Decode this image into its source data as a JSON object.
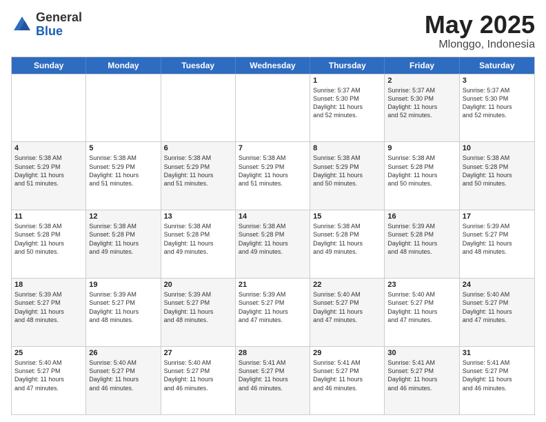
{
  "logo": {
    "general": "General",
    "blue": "Blue"
  },
  "header": {
    "month": "May 2025",
    "location": "Mlonggo, Indonesia"
  },
  "weekdays": [
    "Sunday",
    "Monday",
    "Tuesday",
    "Wednesday",
    "Thursday",
    "Friday",
    "Saturday"
  ],
  "rows": [
    [
      {
        "day": "",
        "text": "",
        "alt": false
      },
      {
        "day": "",
        "text": "",
        "alt": true
      },
      {
        "day": "",
        "text": "",
        "alt": false
      },
      {
        "day": "",
        "text": "",
        "alt": true
      },
      {
        "day": "1",
        "text": "Sunrise: 5:37 AM\nSunset: 5:30 PM\nDaylight: 11 hours\nand 52 minutes.",
        "alt": false
      },
      {
        "day": "2",
        "text": "Sunrise: 5:37 AM\nSunset: 5:30 PM\nDaylight: 11 hours\nand 52 minutes.",
        "alt": true
      },
      {
        "day": "3",
        "text": "Sunrise: 5:37 AM\nSunset: 5:30 PM\nDaylight: 11 hours\nand 52 minutes.",
        "alt": false
      }
    ],
    [
      {
        "day": "4",
        "text": "Sunrise: 5:38 AM\nSunset: 5:29 PM\nDaylight: 11 hours\nand 51 minutes.",
        "alt": true
      },
      {
        "day": "5",
        "text": "Sunrise: 5:38 AM\nSunset: 5:29 PM\nDaylight: 11 hours\nand 51 minutes.",
        "alt": false
      },
      {
        "day": "6",
        "text": "Sunrise: 5:38 AM\nSunset: 5:29 PM\nDaylight: 11 hours\nand 51 minutes.",
        "alt": true
      },
      {
        "day": "7",
        "text": "Sunrise: 5:38 AM\nSunset: 5:29 PM\nDaylight: 11 hours\nand 51 minutes.",
        "alt": false
      },
      {
        "day": "8",
        "text": "Sunrise: 5:38 AM\nSunset: 5:29 PM\nDaylight: 11 hours\nand 50 minutes.",
        "alt": true
      },
      {
        "day": "9",
        "text": "Sunrise: 5:38 AM\nSunset: 5:28 PM\nDaylight: 11 hours\nand 50 minutes.",
        "alt": false
      },
      {
        "day": "10",
        "text": "Sunrise: 5:38 AM\nSunset: 5:28 PM\nDaylight: 11 hours\nand 50 minutes.",
        "alt": true
      }
    ],
    [
      {
        "day": "11",
        "text": "Sunrise: 5:38 AM\nSunset: 5:28 PM\nDaylight: 11 hours\nand 50 minutes.",
        "alt": false
      },
      {
        "day": "12",
        "text": "Sunrise: 5:38 AM\nSunset: 5:28 PM\nDaylight: 11 hours\nand 49 minutes.",
        "alt": true
      },
      {
        "day": "13",
        "text": "Sunrise: 5:38 AM\nSunset: 5:28 PM\nDaylight: 11 hours\nand 49 minutes.",
        "alt": false
      },
      {
        "day": "14",
        "text": "Sunrise: 5:38 AM\nSunset: 5:28 PM\nDaylight: 11 hours\nand 49 minutes.",
        "alt": true
      },
      {
        "day": "15",
        "text": "Sunrise: 5:38 AM\nSunset: 5:28 PM\nDaylight: 11 hours\nand 49 minutes.",
        "alt": false
      },
      {
        "day": "16",
        "text": "Sunrise: 5:39 AM\nSunset: 5:28 PM\nDaylight: 11 hours\nand 48 minutes.",
        "alt": true
      },
      {
        "day": "17",
        "text": "Sunrise: 5:39 AM\nSunset: 5:27 PM\nDaylight: 11 hours\nand 48 minutes.",
        "alt": false
      }
    ],
    [
      {
        "day": "18",
        "text": "Sunrise: 5:39 AM\nSunset: 5:27 PM\nDaylight: 11 hours\nand 48 minutes.",
        "alt": true
      },
      {
        "day": "19",
        "text": "Sunrise: 5:39 AM\nSunset: 5:27 PM\nDaylight: 11 hours\nand 48 minutes.",
        "alt": false
      },
      {
        "day": "20",
        "text": "Sunrise: 5:39 AM\nSunset: 5:27 PM\nDaylight: 11 hours\nand 48 minutes.",
        "alt": true
      },
      {
        "day": "21",
        "text": "Sunrise: 5:39 AM\nSunset: 5:27 PM\nDaylight: 11 hours\nand 47 minutes.",
        "alt": false
      },
      {
        "day": "22",
        "text": "Sunrise: 5:40 AM\nSunset: 5:27 PM\nDaylight: 11 hours\nand 47 minutes.",
        "alt": true
      },
      {
        "day": "23",
        "text": "Sunrise: 5:40 AM\nSunset: 5:27 PM\nDaylight: 11 hours\nand 47 minutes.",
        "alt": false
      },
      {
        "day": "24",
        "text": "Sunrise: 5:40 AM\nSunset: 5:27 PM\nDaylight: 11 hours\nand 47 minutes.",
        "alt": true
      }
    ],
    [
      {
        "day": "25",
        "text": "Sunrise: 5:40 AM\nSunset: 5:27 PM\nDaylight: 11 hours\nand 47 minutes.",
        "alt": false
      },
      {
        "day": "26",
        "text": "Sunrise: 5:40 AM\nSunset: 5:27 PM\nDaylight: 11 hours\nand 46 minutes.",
        "alt": true
      },
      {
        "day": "27",
        "text": "Sunrise: 5:40 AM\nSunset: 5:27 PM\nDaylight: 11 hours\nand 46 minutes.",
        "alt": false
      },
      {
        "day": "28",
        "text": "Sunrise: 5:41 AM\nSunset: 5:27 PM\nDaylight: 11 hours\nand 46 minutes.",
        "alt": true
      },
      {
        "day": "29",
        "text": "Sunrise: 5:41 AM\nSunset: 5:27 PM\nDaylight: 11 hours\nand 46 minutes.",
        "alt": false
      },
      {
        "day": "30",
        "text": "Sunrise: 5:41 AM\nSunset: 5:27 PM\nDaylight: 11 hours\nand 46 minutes.",
        "alt": true
      },
      {
        "day": "31",
        "text": "Sunrise: 5:41 AM\nSunset: 5:27 PM\nDaylight: 11 hours\nand 46 minutes.",
        "alt": false
      }
    ]
  ]
}
